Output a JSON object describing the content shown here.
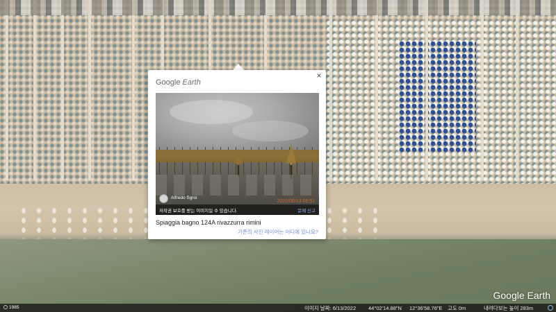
{
  "popup": {
    "close_label": "×",
    "brand_primary": "Google",
    "brand_secondary": "Earth",
    "photo": {
      "author": "Alfredo Sgroi",
      "timestamp": "2022/06/13 06:51",
      "copyright_notice": "저작권 보호를 받는 이미지일 수 있습니다.",
      "report_label": "문제 신고"
    },
    "place_title": "Spiaggia bagno 124A rivazzurra rimini",
    "help_link": "기존의 사진 레이어는 어디에 있나요?"
  },
  "watermark": "Google Earth",
  "statusbar": {
    "year": "1985",
    "imagery_date": "이미지 날짜: 6/13/2022",
    "latitude": "44°02'14.88\"N",
    "longitude": "12°36'58.76\"E",
    "elevation": "고도   0m",
    "eye_altitude": "내려다보는 높이  283m"
  },
  "colors": {
    "popup_bg": "#ffffff",
    "link": "#6a8fd8",
    "blue_umbrellas": "#2c4f9a",
    "sea": "#7f8c6e"
  }
}
